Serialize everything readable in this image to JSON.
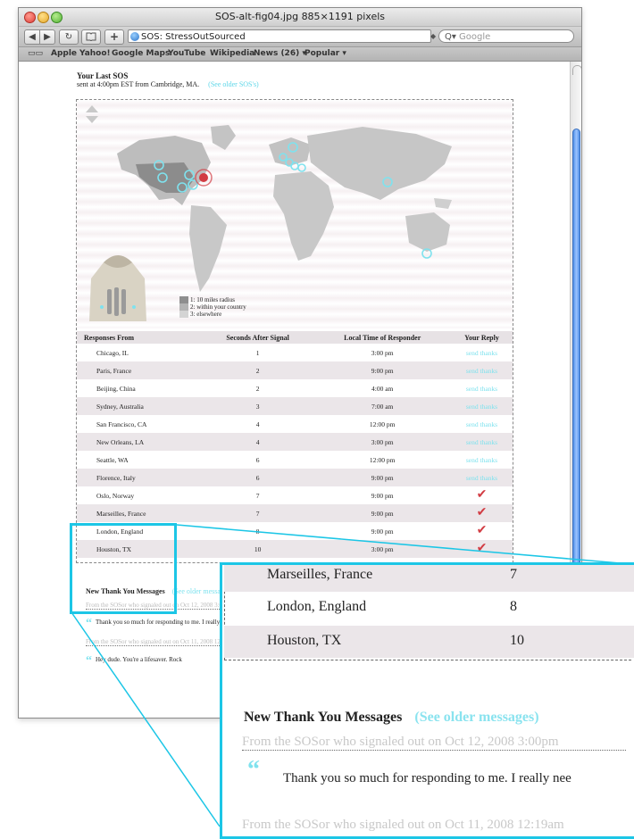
{
  "window": {
    "title": "SOS-alt-fig04.jpg 885×1191 pixels"
  },
  "toolbar": {
    "back_icon": "◀",
    "forward_icon": "▶",
    "reload_icon": "↻",
    "add_icon": "+",
    "url": "SOS: StressOutSourced",
    "search_placeholder": "Google"
  },
  "bookmarks": [
    "Apple",
    "Yahoo!",
    "Google Maps",
    "YouTube",
    "Wikipedia",
    "News (26) ▾",
    "Popular ▾"
  ],
  "sos": {
    "title": "Your Last SOS",
    "subtitle": "sent at 4:00pm EST from Cambridge, MA.",
    "older_link": "(See older SOS's)"
  },
  "legend": [
    {
      "label": "1: 10 miles radius",
      "color": "#8e8e8e"
    },
    {
      "label": "2: within your country",
      "color": "#b3b3b3"
    },
    {
      "label": "3: elsewhere",
      "color": "#d4d4d4"
    }
  ],
  "table": {
    "headers": [
      "Responses From",
      "Seconds After Signal",
      "Local Time of Responder",
      "Your Reply"
    ],
    "rows": [
      {
        "city": "Chicago, IL",
        "seconds": "1",
        "time": "3:00 pm",
        "reply": "send thanks"
      },
      {
        "city": "Paris, France",
        "seconds": "2",
        "time": "9:00 pm",
        "reply": "send thanks"
      },
      {
        "city": "Beijing, China",
        "seconds": "2",
        "time": "4:00 am",
        "reply": "send thanks"
      },
      {
        "city": "Sydney, Australia",
        "seconds": "3",
        "time": "7:00 am",
        "reply": "send thanks"
      },
      {
        "city": "San Francisco, CA",
        "seconds": "4",
        "time": "12:00 pm",
        "reply": "send thanks"
      },
      {
        "city": "New Orleans, LA",
        "seconds": "4",
        "time": "3:00 pm",
        "reply": "send thanks"
      },
      {
        "city": "Seattle, WA",
        "seconds": "6",
        "time": "12:00 pm",
        "reply": "send thanks"
      },
      {
        "city": "Florence, Italy",
        "seconds": "6",
        "time": "9:00 pm",
        "reply": "send thanks"
      },
      {
        "city": "Oslo, Norway",
        "seconds": "7",
        "time": "9:00 pm",
        "reply": "✔"
      },
      {
        "city": "Marseilles, France",
        "seconds": "7",
        "time": "9:00 pm",
        "reply": "✔"
      },
      {
        "city": "London, England",
        "seconds": "8",
        "time": "9:00 pm",
        "reply": "✔"
      },
      {
        "city": "Houston, TX",
        "seconds": "10",
        "time": "3:00 pm",
        "reply": "✔"
      }
    ]
  },
  "messages": {
    "title": "New Thank You Messages",
    "older_link": "(See older messages)",
    "items": [
      {
        "from": "From the SOSor who signaled out on Oct 12, 2008 3:00pm",
        "text": "Thank you so much for responding to me. I really nee"
      },
      {
        "from": "From the SOSor who signaled out on Oct 11, 2008 12:19am",
        "text": "Hey dude. You're a lifesaver. Rock"
      }
    ]
  },
  "zoom": {
    "rows": [
      {
        "city": "Marseilles, France",
        "seconds": "7"
      },
      {
        "city": "London, England",
        "seconds": "8"
      },
      {
        "city": "Houston, TX",
        "seconds": "10"
      }
    ]
  },
  "colors": {
    "accent": "#1cc6e6",
    "link": "#7fe2ee",
    "check": "#d23c43",
    "pin": "#d23c43"
  }
}
